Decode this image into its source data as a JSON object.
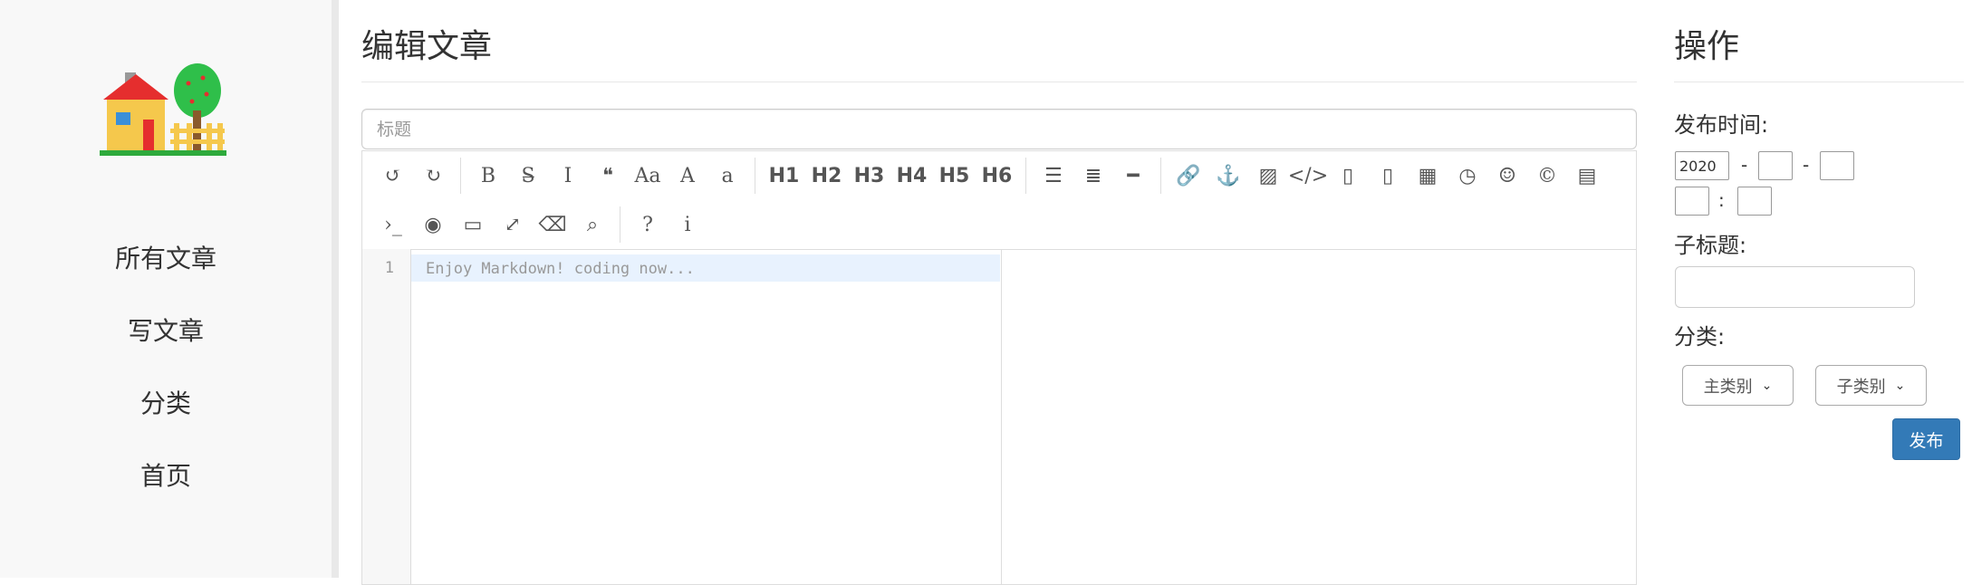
{
  "sidebar": {
    "nav": [
      {
        "label": "所有文章"
      },
      {
        "label": "写文章"
      },
      {
        "label": "分类"
      },
      {
        "label": "首页"
      }
    ]
  },
  "editor": {
    "page_title": "编辑文章",
    "title_placeholder": "标题",
    "toolbar": {
      "row1": [
        {
          "icon": "undo-icon",
          "glyph": "↺"
        },
        {
          "icon": "redo-icon",
          "glyph": "↻"
        },
        {
          "sep": true
        },
        {
          "icon": "bold-icon",
          "glyph": "B"
        },
        {
          "icon": "strikethrough-icon",
          "glyph": "S̶"
        },
        {
          "icon": "italic-icon",
          "glyph": "I"
        },
        {
          "icon": "quote-icon",
          "glyph": "❝"
        },
        {
          "icon": "uppercase-icon",
          "glyph": "Aa"
        },
        {
          "icon": "titlecase-icon",
          "glyph": "A"
        },
        {
          "icon": "lowercase-icon",
          "glyph": "a"
        },
        {
          "sep": true
        },
        {
          "icon": "h1-icon",
          "glyph": "H1",
          "heading": true
        },
        {
          "icon": "h2-icon",
          "glyph": "H2",
          "heading": true
        },
        {
          "icon": "h3-icon",
          "glyph": "H3",
          "heading": true
        },
        {
          "icon": "h4-icon",
          "glyph": "H4",
          "heading": true
        },
        {
          "icon": "h5-icon",
          "glyph": "H5",
          "heading": true
        },
        {
          "icon": "h6-icon",
          "glyph": "H6",
          "heading": true
        },
        {
          "sep": true
        },
        {
          "icon": "unordered-list-icon",
          "glyph": "☰"
        },
        {
          "icon": "ordered-list-icon",
          "glyph": "≣"
        },
        {
          "icon": "horizontal-rule-icon",
          "glyph": "━"
        },
        {
          "sep": true
        },
        {
          "icon": "link-icon",
          "glyph": "🔗"
        },
        {
          "icon": "anchor-icon",
          "glyph": "⚓"
        },
        {
          "icon": "image-icon",
          "glyph": "▨"
        },
        {
          "icon": "inline-code-icon",
          "glyph": "</>"
        },
        {
          "icon": "code-block-icon",
          "glyph": "▯"
        },
        {
          "icon": "preformatted-text-icon",
          "glyph": "▯"
        },
        {
          "icon": "table-icon",
          "glyph": "▦"
        },
        {
          "icon": "datetime-icon",
          "glyph": "◷"
        },
        {
          "icon": "emoji-icon",
          "glyph": "☺"
        },
        {
          "icon": "html-entities-icon",
          "glyph": "©"
        },
        {
          "icon": "pagebreak-icon",
          "glyph": "▤"
        }
      ],
      "row2": [
        {
          "icon": "goto-line-icon",
          "glyph": "›_"
        },
        {
          "icon": "toggle-preview-icon",
          "glyph": "◉"
        },
        {
          "icon": "html-preview-icon",
          "glyph": "▭"
        },
        {
          "icon": "fullscreen-icon",
          "glyph": "⤢"
        },
        {
          "icon": "clear-icon",
          "glyph": "⌫"
        },
        {
          "icon": "search-icon",
          "glyph": "⌕"
        },
        {
          "sep": true
        },
        {
          "icon": "help-icon",
          "glyph": "?"
        },
        {
          "icon": "info-icon",
          "glyph": "i"
        }
      ]
    },
    "line_number": "1",
    "content_placeholder": "Enjoy Markdown! coding now..."
  },
  "ops": {
    "title": "操作",
    "publish_time_label": "发布时间:",
    "year_value": "2020",
    "date_sep1": "-",
    "date_sep2": "-",
    "time_sep": ":",
    "subtitle_label": "子标题:",
    "category_label": "分类:",
    "main_category": "主类别",
    "sub_category": "子类别",
    "publish_label": "发布"
  },
  "colors": {
    "primary": "#337ab7",
    "sidebar_bg": "#f8f8f8",
    "active_line": "#e8f2fe"
  }
}
